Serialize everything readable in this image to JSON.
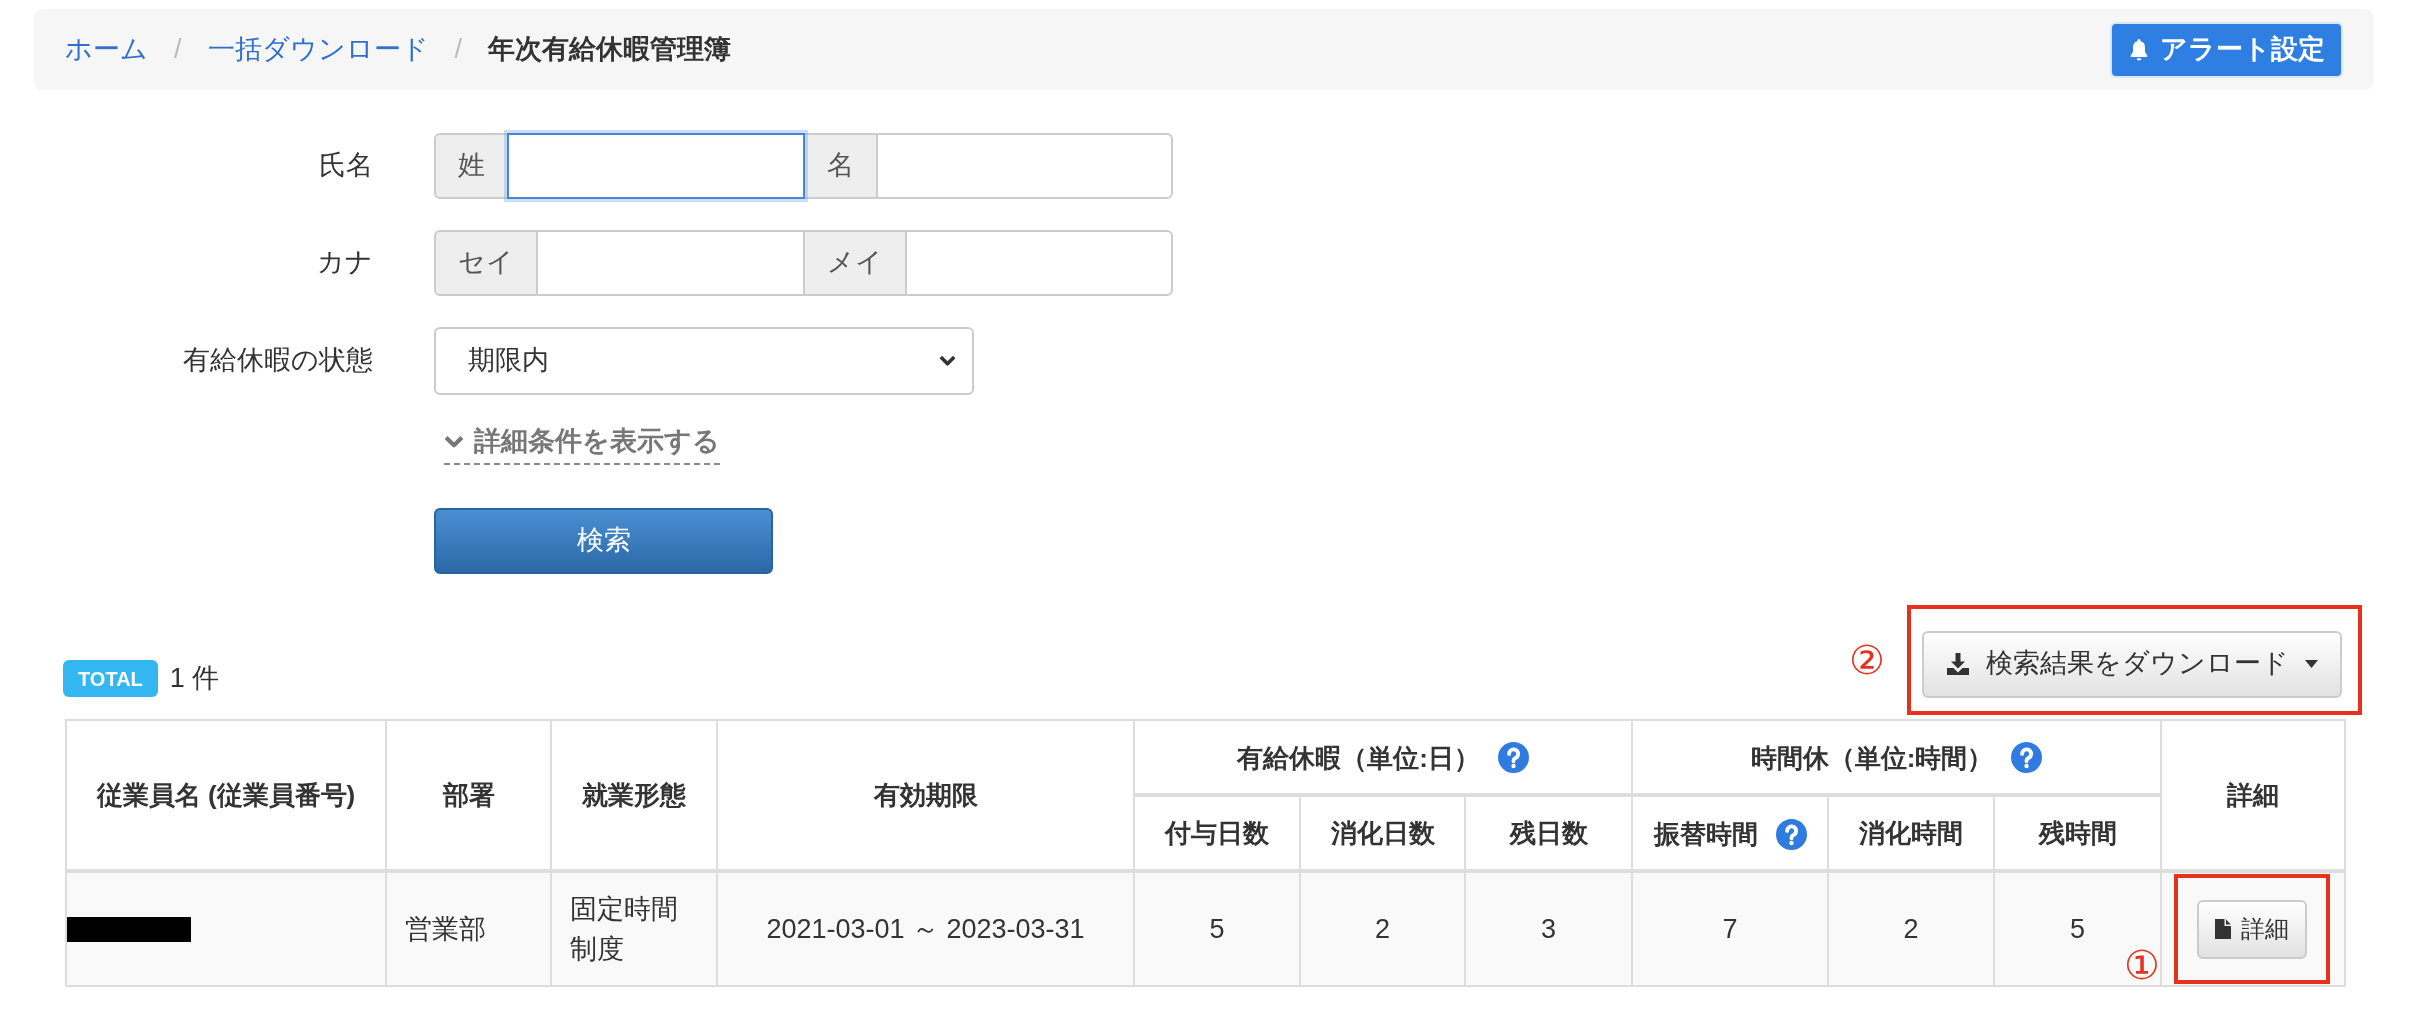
{
  "breadcrumb": [
    {
      "kind": "link",
      "label": "ホーム"
    },
    {
      "kind": "separator",
      "label": "/"
    },
    {
      "kind": "link",
      "label": "一括ダウンロード"
    },
    {
      "kind": "separator",
      "label": "/"
    },
    {
      "kind": "current",
      "label": "年次有給休暇管理簿"
    }
  ],
  "alert_button": {
    "label": "アラート設定"
  },
  "search_form": {
    "fields": [
      {
        "kind": "split",
        "label": "氏名",
        "parts": [
          {
            "addon": "姓",
            "focused": true
          },
          {
            "addon": "名",
            "focused": false
          }
        ]
      },
      {
        "kind": "split",
        "label": "カナ",
        "parts": [
          {
            "addon": "セイ",
            "focused": false
          },
          {
            "addon": "メイ",
            "focused": false
          }
        ]
      },
      {
        "kind": "select",
        "label": "有給休暇の状態",
        "value": "期限内"
      }
    ],
    "toggle": {
      "label": "詳細条件を表示する",
      "expanded": false
    },
    "search_button": {
      "label": "検索"
    }
  },
  "results": {
    "badge": "TOTAL",
    "count": "1 件",
    "download": {
      "marker": "②",
      "label": "検索結果をダウンロード",
      "highlighted": true
    },
    "table": {
      "header_rows": [
        [
          {
            "label": "従業員名 (従業員番号)",
            "rowspan": 2,
            "help": false
          },
          {
            "label": "部署",
            "rowspan": 2,
            "help": false
          },
          {
            "label": "就業形態",
            "rowspan": 2,
            "help": false
          },
          {
            "label": "有効期限",
            "rowspan": 2,
            "help": false
          },
          {
            "label": "有給休暇（単位:日）",
            "colspan": 3,
            "help": true
          },
          {
            "label": "時間休（単位:時間）",
            "colspan": 3,
            "help": true
          },
          {
            "label": "詳細",
            "rowspan": 2,
            "help": false
          }
        ],
        [
          {
            "label": "付与日数",
            "help": false
          },
          {
            "label": "消化日数",
            "help": false
          },
          {
            "label": "残日数",
            "help": false
          },
          {
            "label": "振替時間",
            "help": true
          },
          {
            "label": "消化時間",
            "help": false
          },
          {
            "label": "残時間",
            "help": false
          }
        ]
      ],
      "rows": [
        {
          "cells": [
            {
              "kind": "redacted"
            },
            {
              "kind": "text",
              "text": "営業部"
            },
            {
              "kind": "text",
              "text": "固定時間制度"
            },
            {
              "kind": "range",
              "text": "2021-03-01 ～ 2023-03-31"
            },
            {
              "kind": "number",
              "text": "5"
            },
            {
              "kind": "number",
              "text": "2"
            },
            {
              "kind": "number",
              "text": "3"
            },
            {
              "kind": "number",
              "text": "7"
            },
            {
              "kind": "number",
              "text": "2"
            },
            {
              "kind": "number",
              "text": "5"
            },
            {
              "kind": "button",
              "label": "詳細",
              "marker": "①",
              "highlighted": true
            }
          ]
        }
      ]
    }
  }
}
